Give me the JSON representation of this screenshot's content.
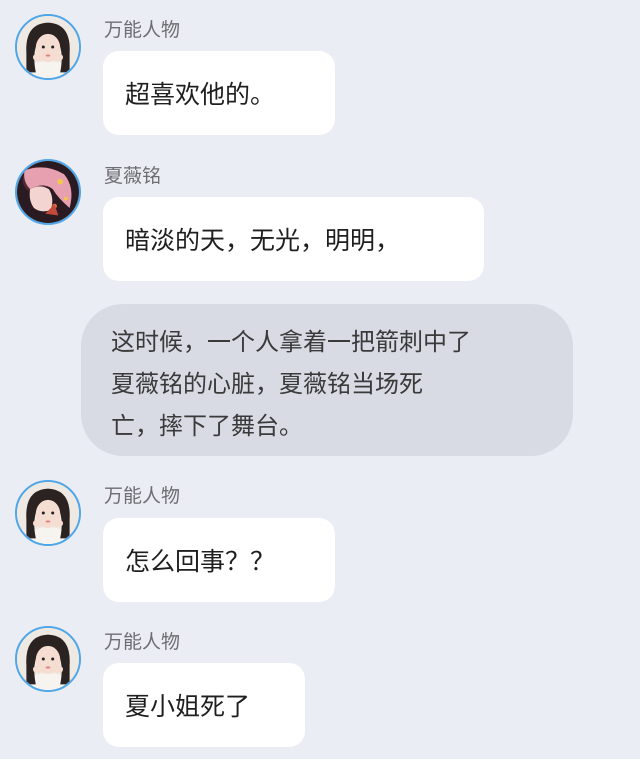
{
  "messages": [
    {
      "type": "incoming",
      "avatar": "girl-avatar-icon",
      "sender": "万能人物",
      "text": "超喜欢他的。"
    },
    {
      "type": "incoming",
      "avatar": "anime-avatar-icon",
      "sender": "夏薇铭",
      "text": "暗淡的天，无光，明明，"
    },
    {
      "type": "narration",
      "lines": [
        "这时候，一个人拿着一把箭刺中了",
        "夏薇铭的心脏，夏薇铭当场死",
        "亡，摔下了舞台。"
      ]
    },
    {
      "type": "incoming",
      "avatar": "girl-avatar-icon",
      "sender": "万能人物",
      "text": "怎么回事？？"
    },
    {
      "type": "incoming",
      "avatar": "girl-avatar-icon",
      "sender": "万能人物",
      "text": "夏小姐死了"
    }
  ],
  "colors": {
    "background": "#ebedf4",
    "bubble": "#ffffff",
    "narration_bubble": "#d8dbe4",
    "avatar_ring": "#4fa6e8"
  }
}
